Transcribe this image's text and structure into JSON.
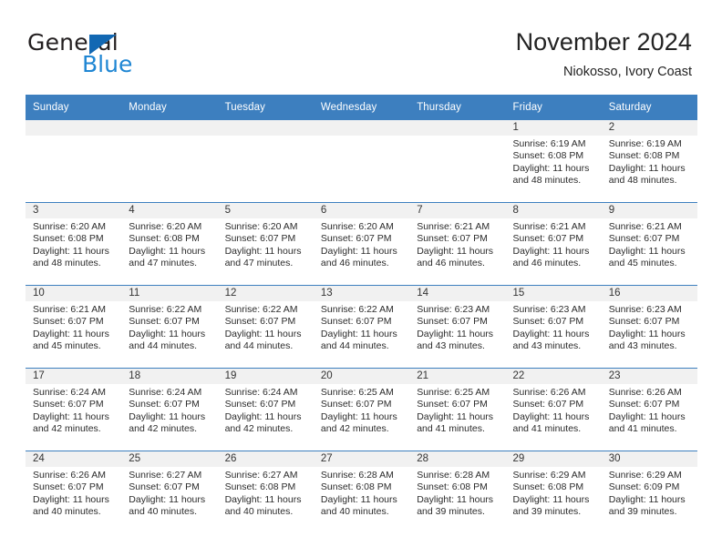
{
  "brand": {
    "word_one": "General",
    "word_two": "Blue",
    "flag_icon": "triangle-flag-icon"
  },
  "header": {
    "title": "November 2024",
    "subtitle": "Niokosso, Ivory Coast"
  },
  "colors": {
    "header_blue": "#3d7fbf",
    "brand_dark": "#231f20",
    "brand_blue": "#1f86d3",
    "daynum_band": "#f1f1f1"
  },
  "columns": [
    "Sunday",
    "Monday",
    "Tuesday",
    "Wednesday",
    "Thursday",
    "Friday",
    "Saturday"
  ],
  "labels": {
    "sunrise_prefix": "Sunrise:",
    "sunset_prefix": "Sunset:",
    "daylight_prefix": "Daylight:"
  },
  "weeks": [
    [
      {
        "day": "",
        "empty": true
      },
      {
        "day": "",
        "empty": true
      },
      {
        "day": "",
        "empty": true
      },
      {
        "day": "",
        "empty": true
      },
      {
        "day": "",
        "empty": true
      },
      {
        "day": "1",
        "sunrise": "Sunrise: 6:19 AM",
        "sunset": "Sunset: 6:08 PM",
        "daylight_1": "Daylight: 11 hours",
        "daylight_2": "and 48 minutes."
      },
      {
        "day": "2",
        "sunrise": "Sunrise: 6:19 AM",
        "sunset": "Sunset: 6:08 PM",
        "daylight_1": "Daylight: 11 hours",
        "daylight_2": "and 48 minutes."
      }
    ],
    [
      {
        "day": "3",
        "sunrise": "Sunrise: 6:20 AM",
        "sunset": "Sunset: 6:08 PM",
        "daylight_1": "Daylight: 11 hours",
        "daylight_2": "and 48 minutes."
      },
      {
        "day": "4",
        "sunrise": "Sunrise: 6:20 AM",
        "sunset": "Sunset: 6:08 PM",
        "daylight_1": "Daylight: 11 hours",
        "daylight_2": "and 47 minutes."
      },
      {
        "day": "5",
        "sunrise": "Sunrise: 6:20 AM",
        "sunset": "Sunset: 6:07 PM",
        "daylight_1": "Daylight: 11 hours",
        "daylight_2": "and 47 minutes."
      },
      {
        "day": "6",
        "sunrise": "Sunrise: 6:20 AM",
        "sunset": "Sunset: 6:07 PM",
        "daylight_1": "Daylight: 11 hours",
        "daylight_2": "and 46 minutes."
      },
      {
        "day": "7",
        "sunrise": "Sunrise: 6:21 AM",
        "sunset": "Sunset: 6:07 PM",
        "daylight_1": "Daylight: 11 hours",
        "daylight_2": "and 46 minutes."
      },
      {
        "day": "8",
        "sunrise": "Sunrise: 6:21 AM",
        "sunset": "Sunset: 6:07 PM",
        "daylight_1": "Daylight: 11 hours",
        "daylight_2": "and 46 minutes."
      },
      {
        "day": "9",
        "sunrise": "Sunrise: 6:21 AM",
        "sunset": "Sunset: 6:07 PM",
        "daylight_1": "Daylight: 11 hours",
        "daylight_2": "and 45 minutes."
      }
    ],
    [
      {
        "day": "10",
        "sunrise": "Sunrise: 6:21 AM",
        "sunset": "Sunset: 6:07 PM",
        "daylight_1": "Daylight: 11 hours",
        "daylight_2": "and 45 minutes."
      },
      {
        "day": "11",
        "sunrise": "Sunrise: 6:22 AM",
        "sunset": "Sunset: 6:07 PM",
        "daylight_1": "Daylight: 11 hours",
        "daylight_2": "and 44 minutes."
      },
      {
        "day": "12",
        "sunrise": "Sunrise: 6:22 AM",
        "sunset": "Sunset: 6:07 PM",
        "daylight_1": "Daylight: 11 hours",
        "daylight_2": "and 44 minutes."
      },
      {
        "day": "13",
        "sunrise": "Sunrise: 6:22 AM",
        "sunset": "Sunset: 6:07 PM",
        "daylight_1": "Daylight: 11 hours",
        "daylight_2": "and 44 minutes."
      },
      {
        "day": "14",
        "sunrise": "Sunrise: 6:23 AM",
        "sunset": "Sunset: 6:07 PM",
        "daylight_1": "Daylight: 11 hours",
        "daylight_2": "and 43 minutes."
      },
      {
        "day": "15",
        "sunrise": "Sunrise: 6:23 AM",
        "sunset": "Sunset: 6:07 PM",
        "daylight_1": "Daylight: 11 hours",
        "daylight_2": "and 43 minutes."
      },
      {
        "day": "16",
        "sunrise": "Sunrise: 6:23 AM",
        "sunset": "Sunset: 6:07 PM",
        "daylight_1": "Daylight: 11 hours",
        "daylight_2": "and 43 minutes."
      }
    ],
    [
      {
        "day": "17",
        "sunrise": "Sunrise: 6:24 AM",
        "sunset": "Sunset: 6:07 PM",
        "daylight_1": "Daylight: 11 hours",
        "daylight_2": "and 42 minutes."
      },
      {
        "day": "18",
        "sunrise": "Sunrise: 6:24 AM",
        "sunset": "Sunset: 6:07 PM",
        "daylight_1": "Daylight: 11 hours",
        "daylight_2": "and 42 minutes."
      },
      {
        "day": "19",
        "sunrise": "Sunrise: 6:24 AM",
        "sunset": "Sunset: 6:07 PM",
        "daylight_1": "Daylight: 11 hours",
        "daylight_2": "and 42 minutes."
      },
      {
        "day": "20",
        "sunrise": "Sunrise: 6:25 AM",
        "sunset": "Sunset: 6:07 PM",
        "daylight_1": "Daylight: 11 hours",
        "daylight_2": "and 42 minutes."
      },
      {
        "day": "21",
        "sunrise": "Sunrise: 6:25 AM",
        "sunset": "Sunset: 6:07 PM",
        "daylight_1": "Daylight: 11 hours",
        "daylight_2": "and 41 minutes."
      },
      {
        "day": "22",
        "sunrise": "Sunrise: 6:26 AM",
        "sunset": "Sunset: 6:07 PM",
        "daylight_1": "Daylight: 11 hours",
        "daylight_2": "and 41 minutes."
      },
      {
        "day": "23",
        "sunrise": "Sunrise: 6:26 AM",
        "sunset": "Sunset: 6:07 PM",
        "daylight_1": "Daylight: 11 hours",
        "daylight_2": "and 41 minutes."
      }
    ],
    [
      {
        "day": "24",
        "sunrise": "Sunrise: 6:26 AM",
        "sunset": "Sunset: 6:07 PM",
        "daylight_1": "Daylight: 11 hours",
        "daylight_2": "and 40 minutes."
      },
      {
        "day": "25",
        "sunrise": "Sunrise: 6:27 AM",
        "sunset": "Sunset: 6:07 PM",
        "daylight_1": "Daylight: 11 hours",
        "daylight_2": "and 40 minutes."
      },
      {
        "day": "26",
        "sunrise": "Sunrise: 6:27 AM",
        "sunset": "Sunset: 6:08 PM",
        "daylight_1": "Daylight: 11 hours",
        "daylight_2": "and 40 minutes."
      },
      {
        "day": "27",
        "sunrise": "Sunrise: 6:28 AM",
        "sunset": "Sunset: 6:08 PM",
        "daylight_1": "Daylight: 11 hours",
        "daylight_2": "and 40 minutes."
      },
      {
        "day": "28",
        "sunrise": "Sunrise: 6:28 AM",
        "sunset": "Sunset: 6:08 PM",
        "daylight_1": "Daylight: 11 hours",
        "daylight_2": "and 39 minutes."
      },
      {
        "day": "29",
        "sunrise": "Sunrise: 6:29 AM",
        "sunset": "Sunset: 6:08 PM",
        "daylight_1": "Daylight: 11 hours",
        "daylight_2": "and 39 minutes."
      },
      {
        "day": "30",
        "sunrise": "Sunrise: 6:29 AM",
        "sunset": "Sunset: 6:09 PM",
        "daylight_1": "Daylight: 11 hours",
        "daylight_2": "and 39 minutes."
      }
    ]
  ]
}
